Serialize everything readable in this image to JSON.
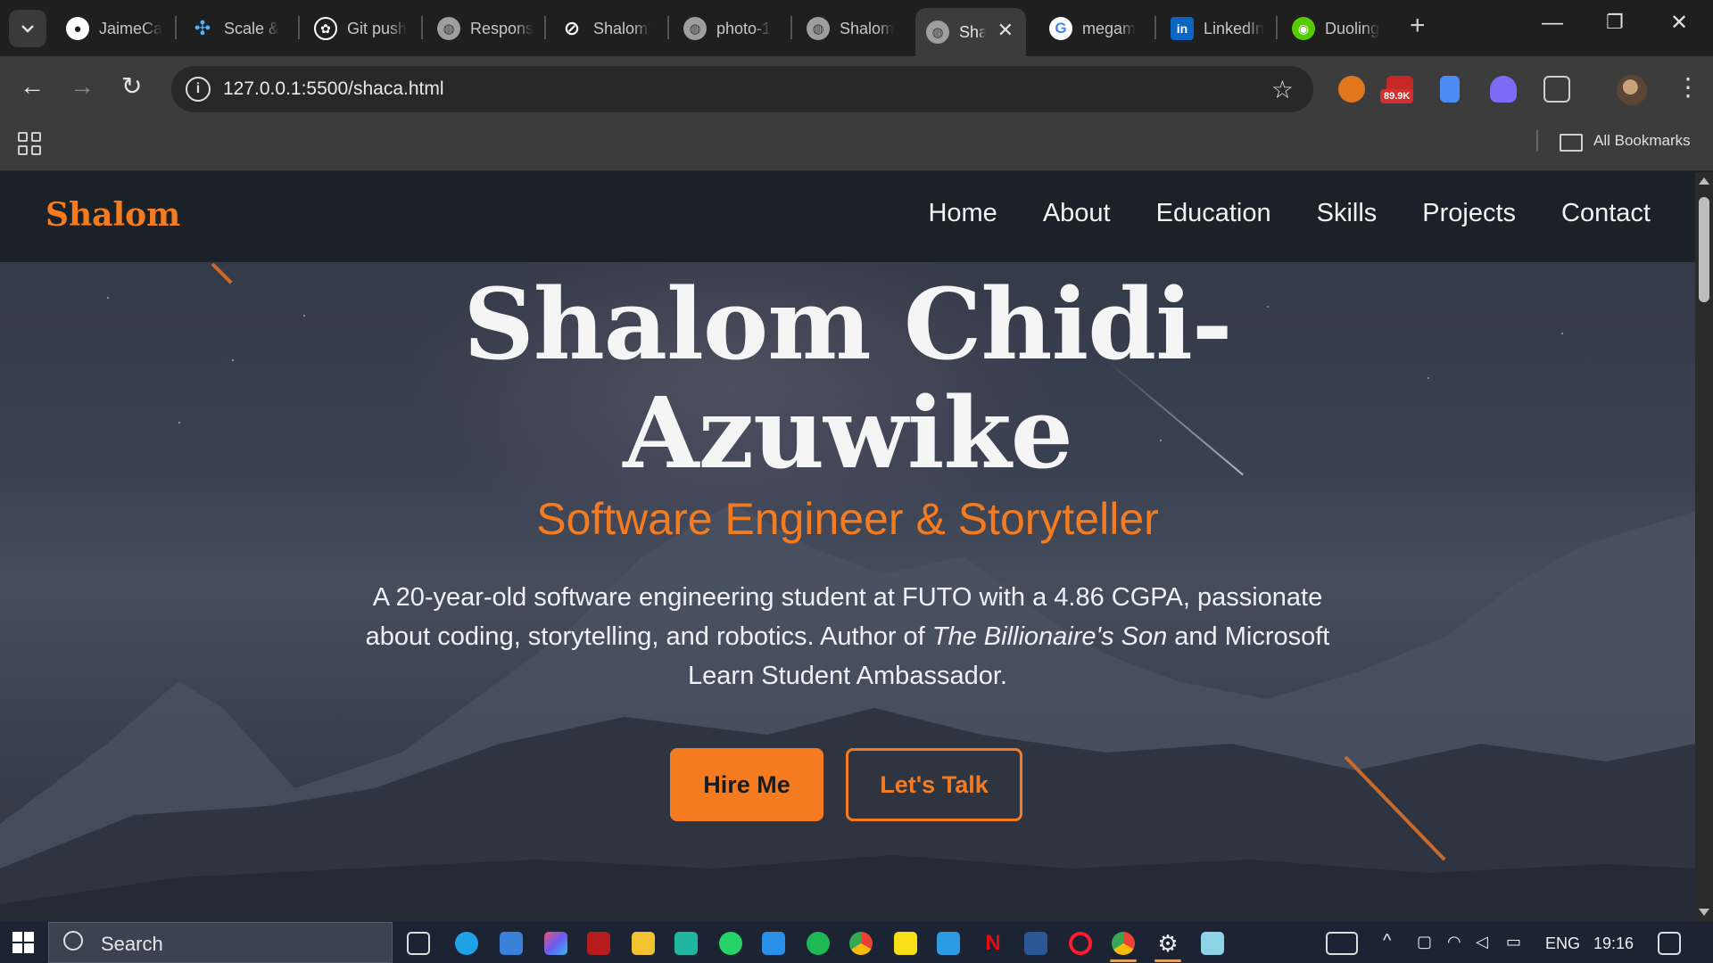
{
  "browser": {
    "tabs": [
      {
        "title": "JaimeCa",
        "icon": "github-icon",
        "color": "#ffffff"
      },
      {
        "title": "Scale &",
        "icon": "scale-icon",
        "color": "#4fb3ff"
      },
      {
        "title": "Git push",
        "icon": "openai-icon",
        "color": "#ffffff"
      },
      {
        "title": "Respons",
        "icon": "globe-icon",
        "color": "#bdbdbd"
      },
      {
        "title": "Shalom'",
        "icon": "ai-icon",
        "color": "#ffffff"
      },
      {
        "title": "photo-1",
        "icon": "globe-icon",
        "color": "#bdbdbd"
      },
      {
        "title": "Shalom",
        "icon": "globe-icon",
        "color": "#bdbdbd"
      },
      {
        "title": "Sha",
        "icon": "globe-icon",
        "color": "#bdbdbd",
        "active": true
      },
      {
        "title": "megam",
        "icon": "google-icon",
        "color": "#ffffff"
      },
      {
        "title": "LinkedIn",
        "icon": "linkedin-icon",
        "color": "#0a66c2"
      },
      {
        "title": "Duoling",
        "icon": "duolingo-icon",
        "color": "#58cc02"
      }
    ],
    "url": "127.0.0.1:5500/shaca.html",
    "extension_badge": "89.9K",
    "bookmarks_label": "All Bookmarks"
  },
  "site": {
    "brand": "Shalom",
    "nav": [
      "Home",
      "About",
      "Education",
      "Skills",
      "Projects",
      "Contact"
    ],
    "hero": {
      "name_line1": "Shalom Chidi-",
      "name_line2": "Azuwike",
      "role": "Software Engineer & Storyteller",
      "bio_part1": "A 20-year-old software engineering student at FUTO with a 4.86 CGPA, passionate about coding, storytelling, and robotics. Author of ",
      "bio_book": "The Billionaire's Son",
      "bio_part2": " and Microsoft Learn Student Ambassador.",
      "primary_cta": "Hire Me",
      "secondary_cta": "Let's Talk"
    },
    "accent_color": "#f47b20"
  },
  "taskbar": {
    "search_label": "Search",
    "language": "ENG",
    "time": "19:16"
  }
}
